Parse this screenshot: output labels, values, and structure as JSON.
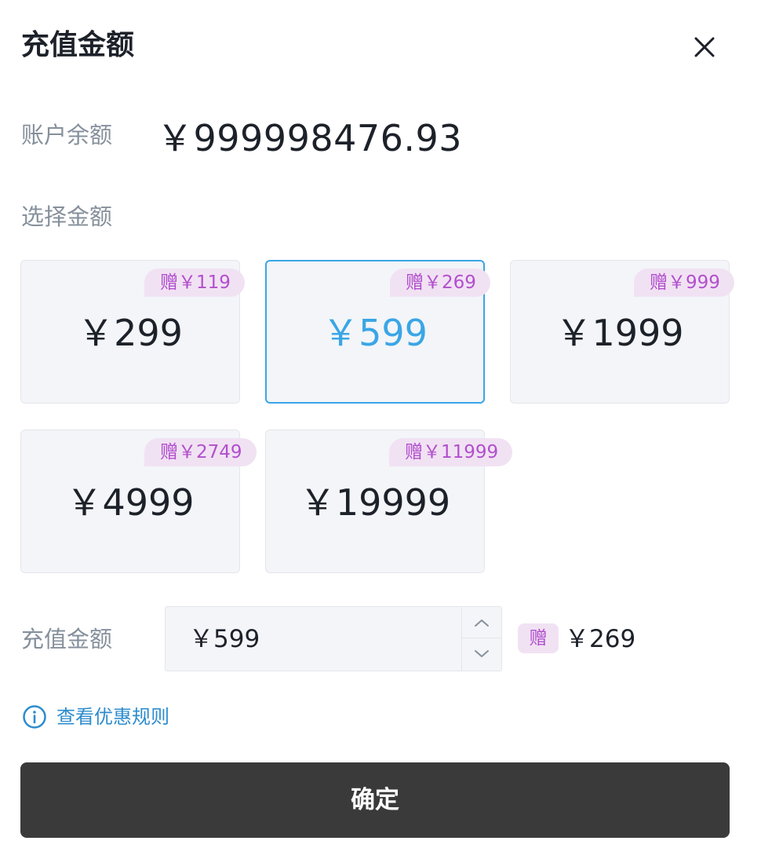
{
  "dialog": {
    "title": "充值金额"
  },
  "balance": {
    "label": "账户余额",
    "value": "￥999998476.93"
  },
  "select": {
    "label": "选择金额",
    "options": [
      {
        "amount": "￥299",
        "gift": "赠￥119",
        "selected": false
      },
      {
        "amount": "￥599",
        "gift": "赠￥269",
        "selected": true
      },
      {
        "amount": "￥1999",
        "gift": "赠￥999",
        "selected": false
      },
      {
        "amount": "￥4999",
        "gift": "赠￥2749",
        "selected": false
      },
      {
        "amount": "￥19999",
        "gift": "赠￥11999",
        "selected": false
      }
    ]
  },
  "recharge": {
    "label": "充值金额",
    "value": "￥599",
    "gift_tag": "赠",
    "gift_amount": "￥269"
  },
  "rules_link": "查看优惠规则",
  "confirm_label": "确定",
  "colors": {
    "accent": "#3aa6e6",
    "gift_text": "#b14fcd",
    "gift_bg": "#f1e2f3",
    "button_bg": "#3b3a3a",
    "link": "#2d8ccd"
  },
  "icons": {
    "close": "close-icon",
    "stepper_up": "chevron-up-icon",
    "stepper_down": "chevron-down-icon",
    "info": "info-circle-icon"
  }
}
